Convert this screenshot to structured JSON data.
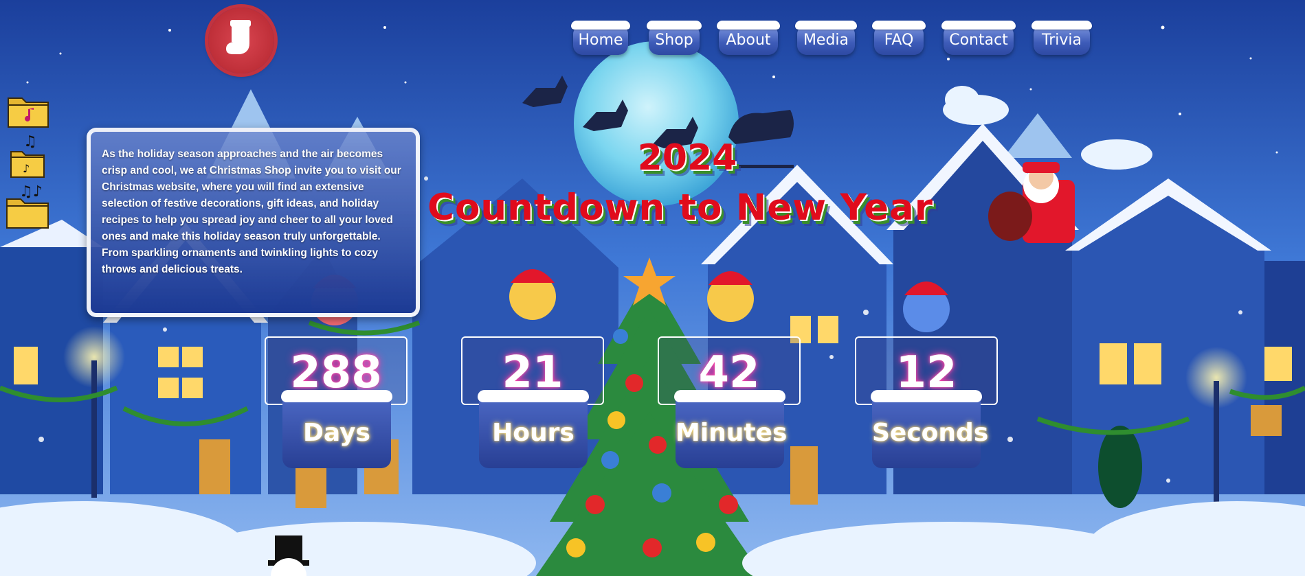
{
  "nav": {
    "items": [
      "Home",
      "Shop",
      "About",
      "Media",
      "FAQ",
      "Contact",
      "Trivia"
    ]
  },
  "intro": {
    "text": "As the holiday season approaches and the air becomes crisp and cool, we at Christmas Shop invite you to visit our Christmas website, where you will find an extensive selection of festive decorations, gift ideas, and holiday recipes to help you spread joy and cheer to all your loved ones and make this holiday season truly unforgettable. From sparkling ornaments and twinkling lights to cozy throws and delicious treats."
  },
  "title": {
    "year": "2024",
    "main": "Countdown to New Year"
  },
  "countdown": [
    {
      "value": "288",
      "label": "Days"
    },
    {
      "value": "21",
      "label": "Hours"
    },
    {
      "value": "42",
      "label": "Minutes"
    },
    {
      "value": "12",
      "label": "Seconds"
    }
  ],
  "icons": {
    "logo": "stocking-icon",
    "folders": [
      "music-folder-icon",
      "music-folder-icon",
      "music-folder-icon"
    ]
  },
  "colors": {
    "title_red": "#e00b1c",
    "nav_blue": "#3d5bb8",
    "logo_red": "#c23340"
  }
}
